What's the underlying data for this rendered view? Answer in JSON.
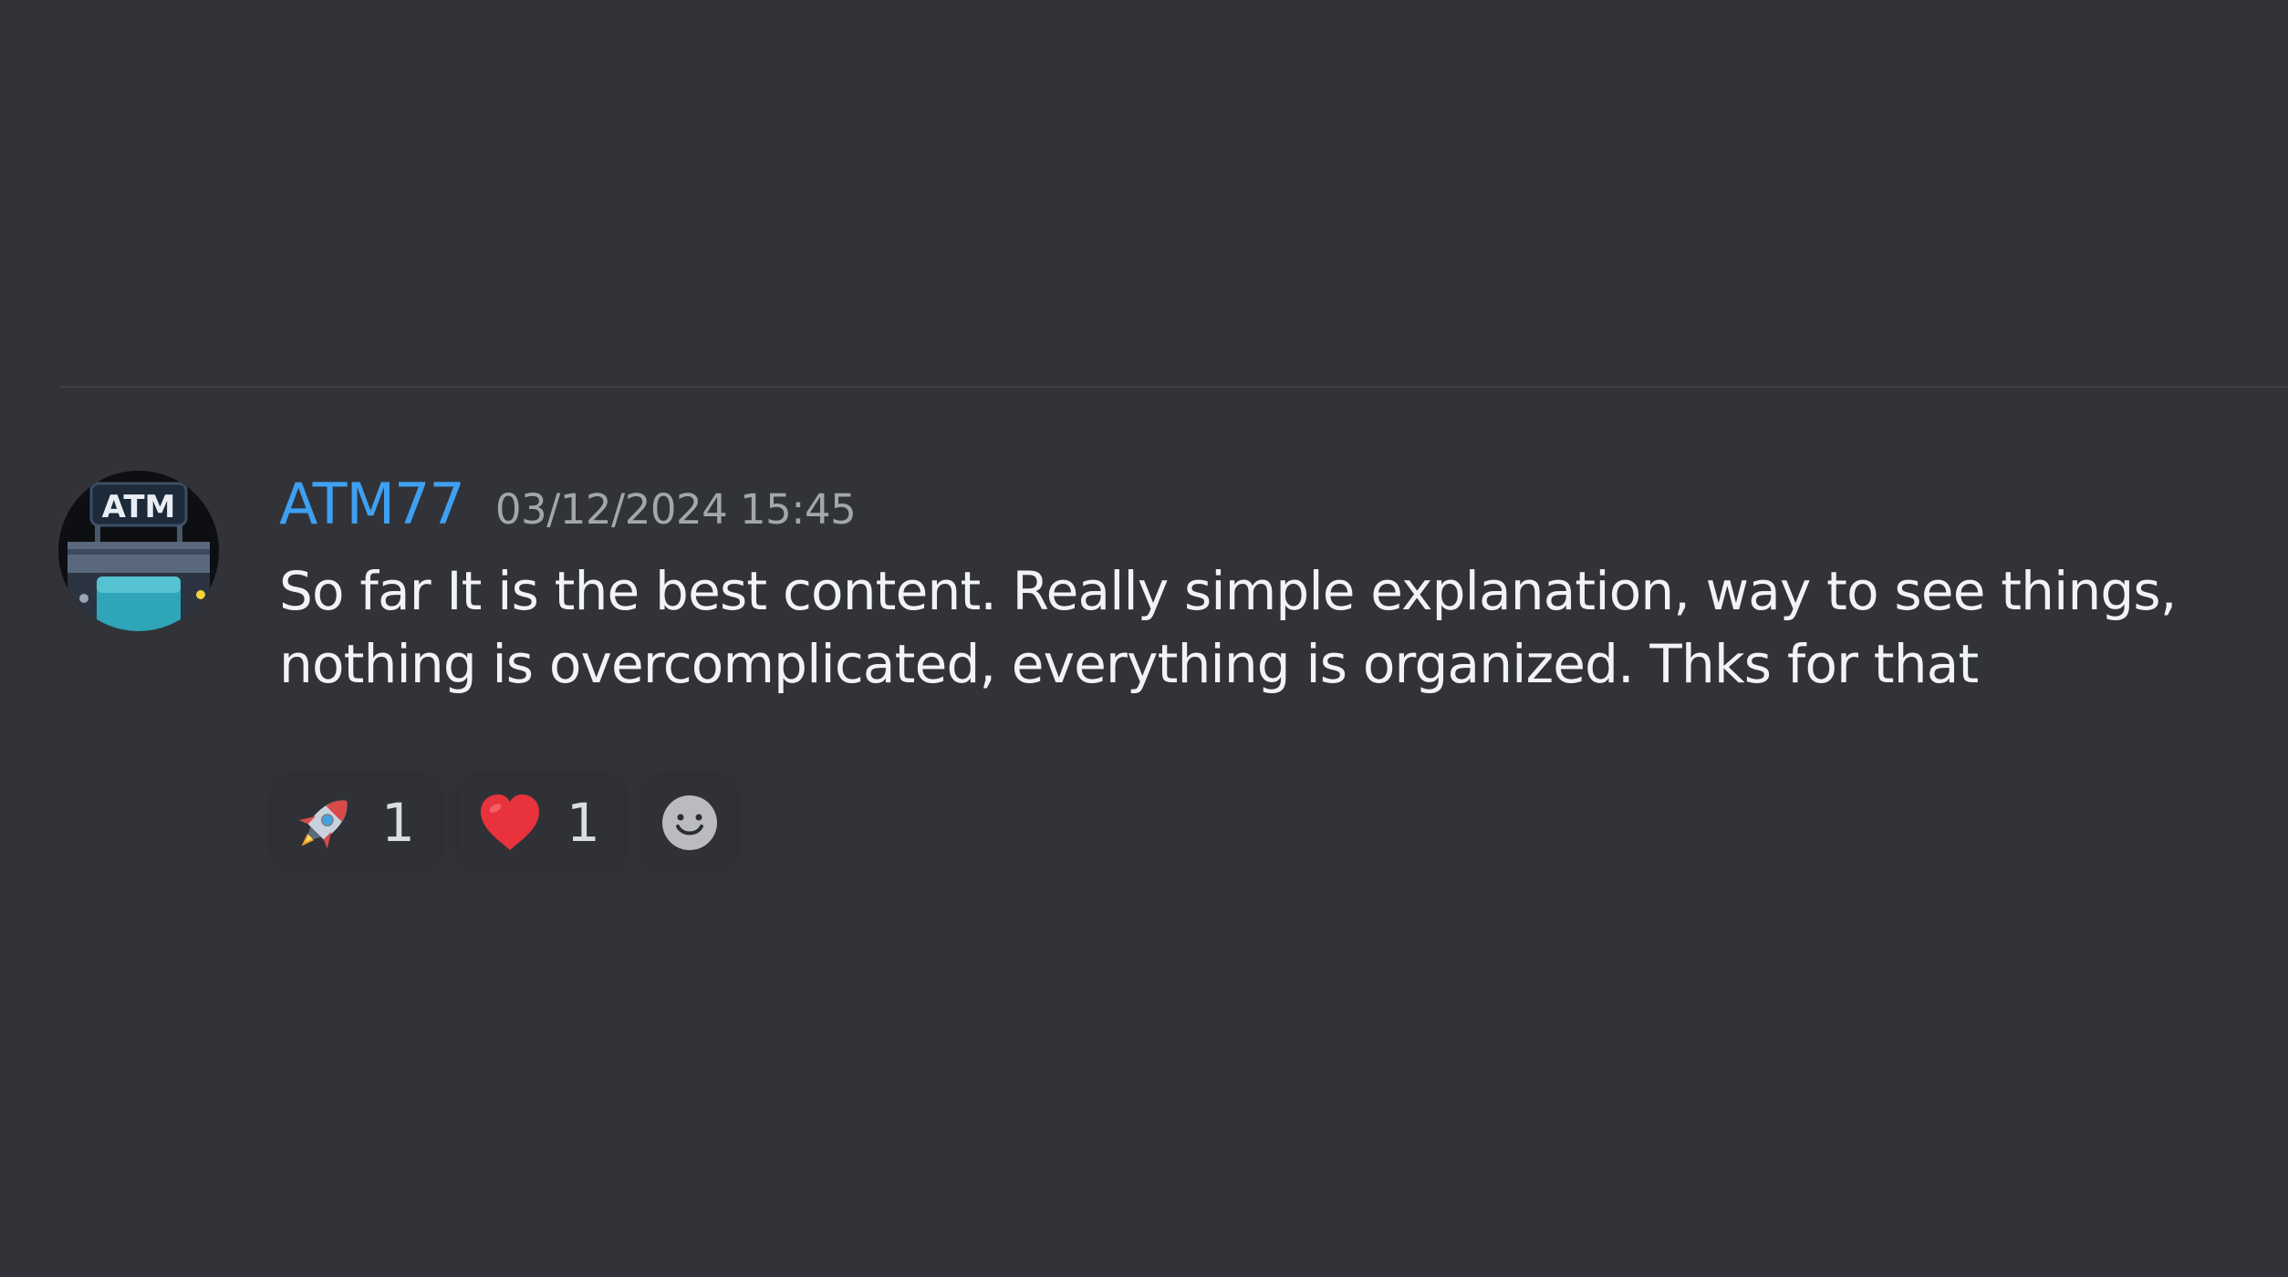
{
  "message": {
    "author": {
      "username": "ATM77",
      "username_color": "#3fa0f2",
      "avatar_text": "ATM",
      "avatar_icon": "atm-machine-avatar"
    },
    "timestamp": "03/12/2024 15:45",
    "content": "So far It is the best content. Really simple explanation, way to see things, nothing is overcomplicated, everything is organized. Thks for that"
  },
  "reactions": [
    {
      "emoji_icon": "rocket-icon",
      "count": "1"
    },
    {
      "emoji_icon": "red-heart-icon",
      "count": "1"
    }
  ],
  "add_reaction_icon": "smiley-add-reaction-icon",
  "colors": {
    "background": "#313338",
    "text": "#f2f3f5",
    "timestamp": "#a3a6aa"
  }
}
